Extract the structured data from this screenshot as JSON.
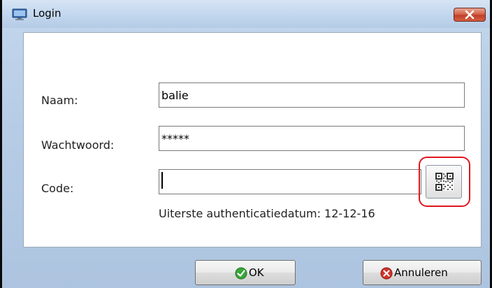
{
  "window": {
    "title": "Login",
    "close_icon": "close-icon",
    "app_icon": "monitor-icon"
  },
  "form": {
    "name_label": "Naam:",
    "name_value": "balie",
    "password_label": "Wachtwoord:",
    "password_value": "*****",
    "code_label": "Code:",
    "code_value": "",
    "qr_icon": "qr-code-icon",
    "expiry_text": "Uiterste authenticatiedatum: 12-12-16"
  },
  "buttons": {
    "ok_label": "OK",
    "ok_icon": "check-icon",
    "cancel_label": "Annuleren",
    "cancel_icon": "cancel-icon"
  },
  "colors": {
    "highlight": "#e0161f",
    "ok_green": "#3aa43a",
    "cancel_red": "#d0342c",
    "close_red": "#c0402a"
  }
}
